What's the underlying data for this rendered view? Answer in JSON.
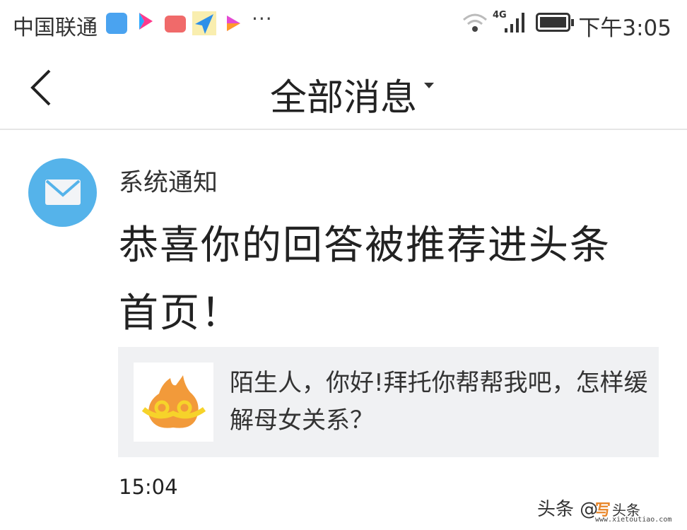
{
  "status_bar": {
    "carrier": "中国联通",
    "notification_icons": [
      "wifi-hotspot-icon",
      "youku-icon",
      "toutiao-icon",
      "paper-plane-icon",
      "video-play-icon"
    ],
    "more": "···",
    "network": "4G",
    "time": "下午3:05"
  },
  "header": {
    "title": "全部消息",
    "back_icon": "chevron-left-icon",
    "dropdown_icon": "caret-down-icon"
  },
  "message": {
    "sender": "系统通知",
    "avatar_icon": "envelope-icon",
    "avatar_color": "#55b3ea",
    "text": "恭喜你的回答被推荐进头条首页！",
    "card": {
      "text": "陌生人，你好!拜托你帮帮我吧，怎样缓解母女关系？",
      "thumbnail_icon": "flame-logo-icon"
    },
    "time": "15:04"
  },
  "watermark": {
    "left": "头条 @",
    "brand": "写",
    "brand_rest": "头条",
    "url": "www.xietoutiao.com"
  }
}
